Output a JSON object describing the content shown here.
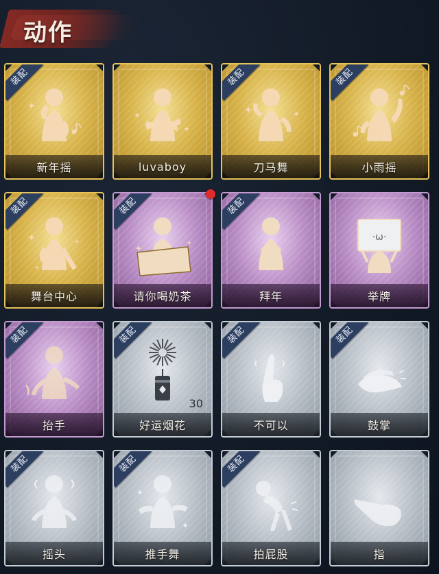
{
  "header": {
    "title": "动作"
  },
  "colors": {
    "gold": "#d9b54c",
    "purple": "#b88cc4",
    "silver": "#b7bec6",
    "equip_badge": "#2d3f60",
    "new_dot": "#e02b2b"
  },
  "equip_label": "装配",
  "actions": [
    {
      "label": "新年摇",
      "rarity": "gold",
      "equipped": true,
      "icon": "dance-figure-music-icon"
    },
    {
      "label": "luvaboy",
      "rarity": "gold",
      "equipped": false,
      "icon": "arms-crossed-figure-icon"
    },
    {
      "label": "刀马舞",
      "rarity": "gold",
      "equipped": true,
      "icon": "dance-figure-sparkle-icon"
    },
    {
      "label": "小雨摇",
      "rarity": "gold",
      "equipped": true,
      "icon": "wave-figure-music-icon"
    },
    {
      "label": "舞台中心",
      "rarity": "gold",
      "equipped": true,
      "icon": "pose-figure-sparkle-icon"
    },
    {
      "label": "请你喝奶茶",
      "rarity": "purple",
      "equipped": true,
      "icon": "figure-holding-banner-icon",
      "new": true
    },
    {
      "label": "拜年",
      "rarity": "purple",
      "equipped": true,
      "icon": "greeting-figure-icon"
    },
    {
      "label": "举牌",
      "rarity": "purple",
      "equipped": false,
      "icon": "figure-holding-sign-icon"
    },
    {
      "label": "抬手",
      "rarity": "purple",
      "equipped": true,
      "icon": "raise-hand-figure-icon"
    },
    {
      "label": "好运烟花",
      "rarity": "silver",
      "equipped": true,
      "icon": "firework-icon",
      "count": "30"
    },
    {
      "label": "不可以",
      "rarity": "silver",
      "equipped": true,
      "icon": "finger-wag-icon"
    },
    {
      "label": "鼓掌",
      "rarity": "silver",
      "equipped": true,
      "icon": "clapping-hands-icon"
    },
    {
      "label": "摇头",
      "rarity": "silver",
      "equipped": true,
      "icon": "head-shake-figure-icon"
    },
    {
      "label": "推手舞",
      "rarity": "silver",
      "equipped": true,
      "icon": "push-hands-dance-icon"
    },
    {
      "label": "拍屁股",
      "rarity": "silver",
      "equipped": true,
      "icon": "bent-over-figure-icon"
    },
    {
      "label": "指",
      "rarity": "silver",
      "equipped": false,
      "icon": "pointing-hand-icon"
    }
  ]
}
